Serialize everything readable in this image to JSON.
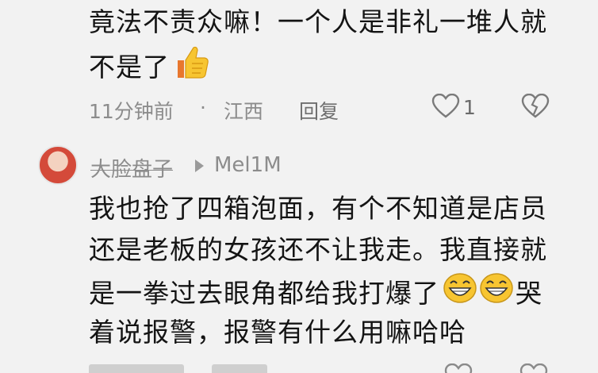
{
  "comment1": {
    "text_line1": "竟法不责众嘛！一个人是非礼一堆人就",
    "text_line2": "不是了",
    "emoji": "thumbs-up",
    "time": "11分钟前",
    "dot": "·",
    "location": "江西",
    "reply_label": "回复",
    "like_count": "1"
  },
  "reply1": {
    "username": "大脸盘子",
    "reply_to": "Mel1M",
    "lines": [
      "我也抢了四箱泡面，有个不知道是店员",
      "还是老板的女孩还不让我走。我直接就",
      "是一拳过去眼角都给我打爆了",
      "着说报警，报警有什么用嘛哈哈"
    ],
    "line3_suffix": "哭",
    "emoji": "grinning-face"
  },
  "colors": {
    "background": "#f2f2f2",
    "text": "#141414",
    "meta": "#8c8c8c",
    "emoji_yellow": "#f7c531"
  }
}
